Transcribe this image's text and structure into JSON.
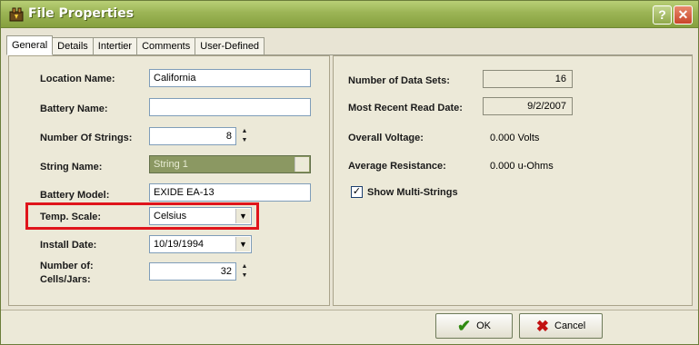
{
  "window": {
    "title": "File Properties",
    "help_glyph": "?",
    "close_glyph": "✕"
  },
  "tabs": [
    {
      "label": "General",
      "active": true
    },
    {
      "label": "Details",
      "active": false
    },
    {
      "label": "Intertier",
      "active": false
    },
    {
      "label": "Comments",
      "active": false
    },
    {
      "label": "User-Defined",
      "active": false
    }
  ],
  "general": {
    "location_name_label": "Location Name:",
    "location_name_value": "California",
    "battery_name_label": "Battery Name:",
    "battery_name_value": "",
    "number_of_strings_label": "Number Of Strings:",
    "number_of_strings_value": "8",
    "string_name_label": "String Name:",
    "string_name_value": "String 1",
    "battery_model_label": "Battery Model:",
    "battery_model_value": "EXIDE EA-13",
    "temp_scale_label": "Temp. Scale:",
    "temp_scale_value": "Celsius",
    "install_date_label": "Install Date:",
    "install_date_value": "10/19/1994",
    "cells_jars_label_line1": "Number of:",
    "cells_jars_label_line2": "Cells/Jars:",
    "cells_jars_value": "32"
  },
  "summary": {
    "data_sets_label": "Number of Data Sets:",
    "data_sets_value": "16",
    "recent_read_label": "Most Recent Read Date:",
    "recent_read_value": "9/2/2007",
    "overall_voltage_label": "Overall Voltage:",
    "overall_voltage_value": "0.000 Volts",
    "avg_resistance_label": "Average Resistance:",
    "avg_resistance_value": "0.000 u-Ohms",
    "show_multi_label": "Show Multi-Strings",
    "show_multi_checked": true,
    "check_glyph": "✓"
  },
  "buttons": {
    "ok_label": "OK",
    "cancel_label": "Cancel"
  },
  "glyphs": {
    "dropdown": "▼",
    "spin_up": "▲",
    "spin_down": "▼",
    "ok_icon": "✔",
    "cancel_icon": "✖"
  },
  "colors": {
    "titlebar": "#9bb455",
    "highlight_border": "#e0151c",
    "string_name_bg": "#8b9862"
  }
}
